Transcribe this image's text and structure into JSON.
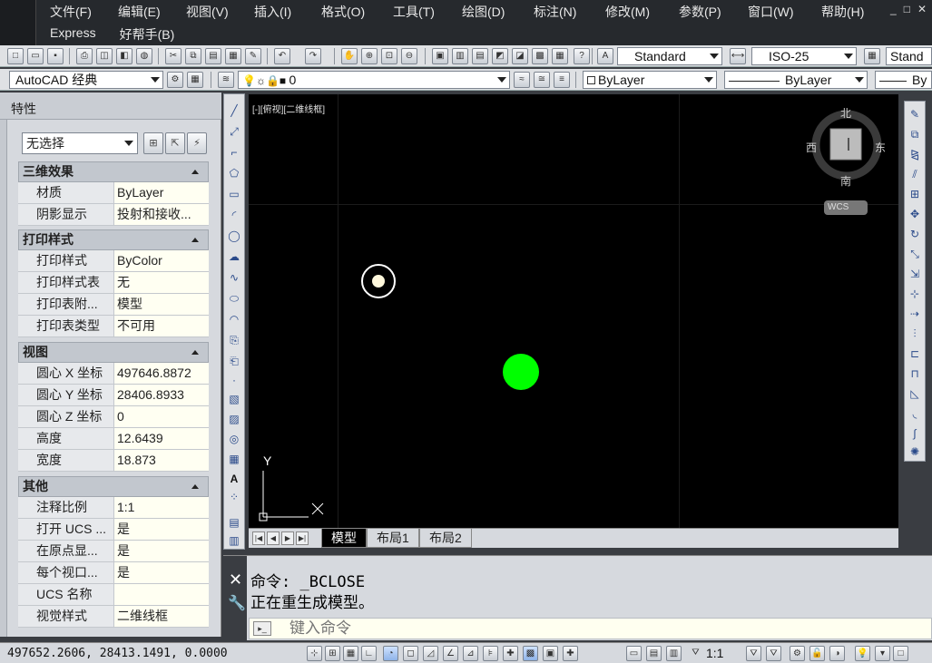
{
  "menubar": {
    "items": [
      "文件(F)",
      "编辑(E)",
      "视图(V)",
      "插入(I)",
      "格式(O)",
      "工具(T)",
      "绘图(D)",
      "标注(N)",
      "修改(M)",
      "参数(P)",
      "窗口(W)",
      "帮助(H)"
    ],
    "items2": [
      "Express",
      "好帮手(B)"
    ],
    "win_ctrls": [
      "_",
      "□",
      "✕"
    ]
  },
  "toolbar1": {
    "text_style": "Standard",
    "dim_style": "ISO-25",
    "table_style": "Stand"
  },
  "toolbar2": {
    "workspace": "AutoCAD 经典",
    "layer": "0",
    "color": "ByLayer",
    "linetype": "ByLayer",
    "lineweight": "By"
  },
  "properties": {
    "title": "特性",
    "selection": "无选择",
    "groups": [
      {
        "name": "三维效果",
        "rows": [
          [
            "材质",
            "ByLayer"
          ],
          [
            "阴影显示",
            "投射和接收..."
          ]
        ]
      },
      {
        "name": "打印样式",
        "rows": [
          [
            "打印样式",
            "ByColor"
          ],
          [
            "打印样式表",
            "无"
          ],
          [
            "打印表附...",
            "模型"
          ],
          [
            "打印表类型",
            "不可用"
          ]
        ]
      },
      {
        "name": "视图",
        "rows": [
          [
            "圆心 X 坐标",
            "497646.8872"
          ],
          [
            "圆心 Y 坐标",
            "28406.8933"
          ],
          [
            "圆心 Z 坐标",
            "0"
          ],
          [
            "高度",
            "12.6439"
          ],
          [
            "宽度",
            "18.873"
          ]
        ]
      },
      {
        "name": "其他",
        "rows": [
          [
            "注释比例",
            "1:1"
          ],
          [
            "打开 UCS ...",
            "是"
          ],
          [
            "在原点显...",
            "是"
          ],
          [
            "每个视口...",
            "是"
          ],
          [
            "UCS 名称",
            ""
          ],
          [
            "视觉样式",
            "二维线框"
          ]
        ]
      }
    ]
  },
  "viewport": {
    "label": "[-][俯视][二维线框]",
    "viewcube": {
      "north": "北",
      "south": "南",
      "east": "东",
      "west": "西",
      "wcs": "WCS"
    },
    "ucs": {
      "x": "X",
      "y": "Y"
    },
    "colors": {
      "background": "#000000",
      "green_circle": "#00ff00",
      "white": "#ffffff"
    }
  },
  "tabs": [
    "模型",
    "布局1",
    "布局2"
  ],
  "command": {
    "history": [
      "命令: _BCLOSE",
      "正在重生成模型。"
    ],
    "placeholder": "键入命令"
  },
  "status": {
    "coords": "497652.2606, 28413.1491, 0.0000",
    "scale": "1:1"
  }
}
